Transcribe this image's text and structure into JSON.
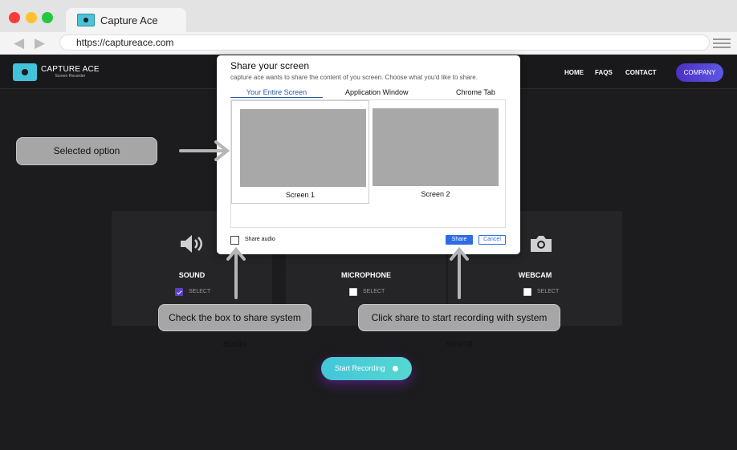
{
  "browser": {
    "tab_title": "Capture Ace",
    "url": "https://captureace.com",
    "traffic_colors": [
      "#fe3b3b",
      "#ffc22d",
      "#23c840"
    ]
  },
  "site": {
    "logo_title": "CAPTURE ACE",
    "logo_subtitle": "Screen Recorder",
    "nav": [
      "HOME",
      "FAQS",
      "CONTACT"
    ],
    "company_button": "COMPANY",
    "cards": [
      {
        "label": "SOUND",
        "checkbox_label": "SELECT",
        "checked": true,
        "icon": "speaker-icon"
      },
      {
        "label": "MICROPHONE",
        "checkbox_label": "SELECT",
        "checked": false,
        "icon": "microphone-icon"
      },
      {
        "label": "WEBCAM",
        "checkbox_label": "SELECT",
        "checked": false,
        "icon": "camera-icon"
      }
    ],
    "start_button": "Start Recording",
    "accent_color": "#5a3ec5"
  },
  "dialog": {
    "title": "Share your screen",
    "description": "capture ace wants to share the content of you screen. Choose what you'd like to share.",
    "tabs": [
      "Your Entire Screen",
      "Application Window",
      "Chrome Tab"
    ],
    "active_tab": "Your Entire Screen",
    "screens": [
      "Screen 1",
      "Screen 2"
    ],
    "share_audio_label": "Share audio",
    "share_button": "Share",
    "cancel_button": "Cancel"
  },
  "callouts": {
    "selected_option": "Selected option",
    "share_audio_hint": "Check the box to share system audio",
    "share_hint": "Click share to start recording with system sound"
  }
}
